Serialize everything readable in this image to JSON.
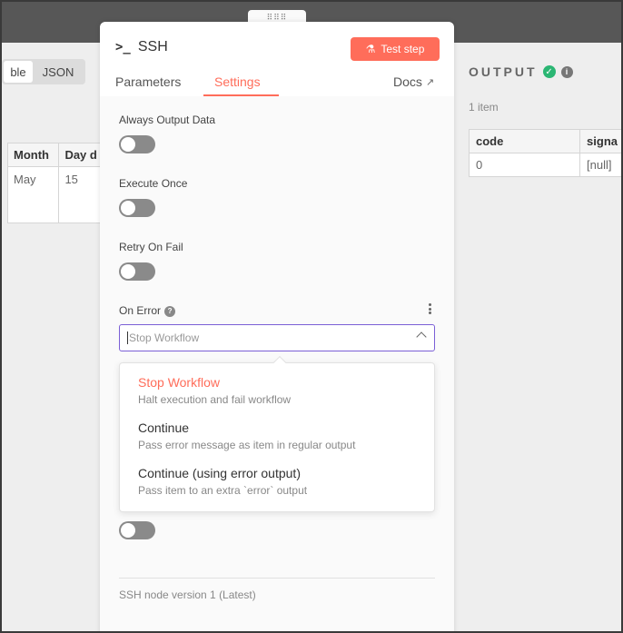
{
  "input_panel": {
    "view_toggle": {
      "table_label": "ble",
      "json_label": "JSON"
    },
    "table": {
      "headers": [
        "Month",
        "Day d"
      ],
      "rows": [
        [
          "May",
          "15"
        ]
      ]
    }
  },
  "output_panel": {
    "title": "OUTPUT",
    "item_count": "1 item",
    "table": {
      "headers": [
        "code",
        "signa"
      ],
      "rows": [
        [
          "0",
          "[null]"
        ]
      ]
    }
  },
  "node": {
    "title": "SSH",
    "test_button": "Test step",
    "tabs": {
      "parameters": "Parameters",
      "settings": "Settings",
      "docs": "Docs"
    }
  },
  "settings": {
    "always_output_data": "Always Output Data",
    "execute_once": "Execute Once",
    "retry_on_fail": "Retry On Fail",
    "on_error": {
      "label": "On Error",
      "selected": "Stop Workflow",
      "options": [
        {
          "title": "Stop Workflow",
          "description": "Halt execution and fail workflow"
        },
        {
          "title": "Continue",
          "description": "Pass error message as item in regular output"
        },
        {
          "title": "Continue (using error output)",
          "description": "Pass item to an extra `error` output"
        }
      ]
    },
    "version": "SSH node version 1 (Latest)"
  },
  "colors": {
    "accent": "#ff6d5a",
    "focus": "#7b5fd6",
    "success": "#2bb673"
  }
}
